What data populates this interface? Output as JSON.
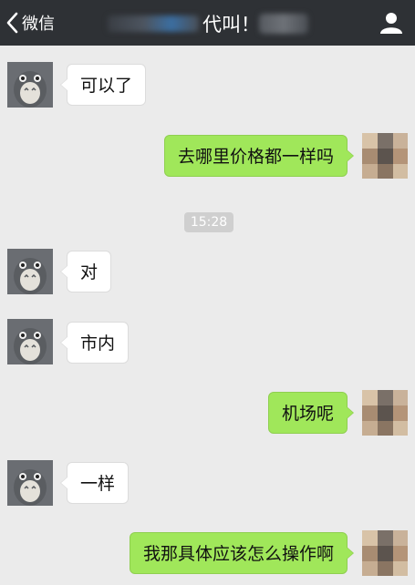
{
  "header": {
    "back_label": "微信",
    "back_icon": "chevron-left-icon",
    "title_visible": "代叫！",
    "profile_icon": "person-icon"
  },
  "timestamp": "15:28",
  "messages": [
    {
      "side": "left",
      "text": "可以了"
    },
    {
      "side": "right",
      "text": "去哪里价格都一样吗"
    },
    {
      "side": "left",
      "text": "对"
    },
    {
      "side": "left",
      "text": "市内"
    },
    {
      "side": "right",
      "text": "机场呢"
    },
    {
      "side": "left",
      "text": "一样"
    },
    {
      "side": "right",
      "text": "我那具体应该怎么操作啊"
    }
  ],
  "colors": {
    "topbar": "#2e3135",
    "background": "#ebebeb",
    "sent_bubble": "#a0e75a",
    "received_bubble": "#ffffff",
    "timestamp_pill": "#cfcfcf"
  }
}
